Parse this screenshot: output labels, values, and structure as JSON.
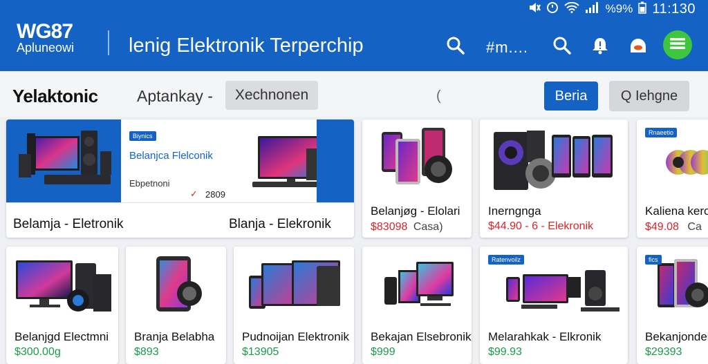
{
  "status_bar": {
    "battery_text": "%9%",
    "time": "11:130"
  },
  "header": {
    "logo_line1": "WG87",
    "logo_line2": "Apluneowi",
    "title": "lenig Elektronik Terperchip",
    "menu_text": "#m...."
  },
  "toolbar": {
    "brand": "Yelaktonic",
    "search_text": "Aptankay -",
    "chip_label": "Xechnonen",
    "cursor": "(",
    "primary_button": "Beria",
    "secondary_button": "Q Iehgne"
  },
  "banner": {
    "tag": "Biynics",
    "headline": "Belanjca Flelconik",
    "sub": "Ebpetnoni",
    "check": "✓",
    "number": "2809",
    "caption_left": "Belamja - Eletronik",
    "caption_right": "Blanja - Elekronik"
  },
  "products_row1": [
    {
      "name": "Belanjøg - Elolari",
      "price": "$83098",
      "price_suffix": "Casa)",
      "price_color": "red"
    },
    {
      "name": "Inerngnga",
      "price": "$44.90 - 6 - Elekronik",
      "price_suffix": "",
      "price_color": "red",
      "tag": ""
    },
    {
      "name": "Kaliena keron",
      "price": "$49.08",
      "price_suffix": "Ca",
      "price_color": "red",
      "tag": "Rnaeetio"
    }
  ],
  "products_row2": [
    {
      "name": "Belanjgd Electmni",
      "price": "$300.00g",
      "price_color": "green",
      "tag": ""
    },
    {
      "name": "Branja Belabha",
      "price": "$893",
      "price_color": "green",
      "tag": ""
    },
    {
      "name": "Pudnoijan Elektronik",
      "price": "$13905",
      "price_color": "green",
      "tag": ""
    },
    {
      "name": "Bekajan Elsebronik",
      "price": "$999",
      "price_color": "green",
      "tag": ""
    },
    {
      "name": "Melarahkak - Elkronik",
      "price": "$99.93",
      "price_color": "green",
      "tag": "Ratenvoilz"
    },
    {
      "name": "Bekanjondela",
      "price": "$29393",
      "price_color": "green",
      "tag": "fics"
    }
  ],
  "icons": [
    "wifi-icon",
    "signal-icon",
    "battery-icon",
    "search-icon",
    "bell-icon",
    "chat-icon",
    "menu-icon"
  ],
  "colors": {
    "header_blue": "#1462c4",
    "accent_green": "#3ec63e",
    "price_red": "#d8262a",
    "price_green": "#1a9a4a"
  }
}
